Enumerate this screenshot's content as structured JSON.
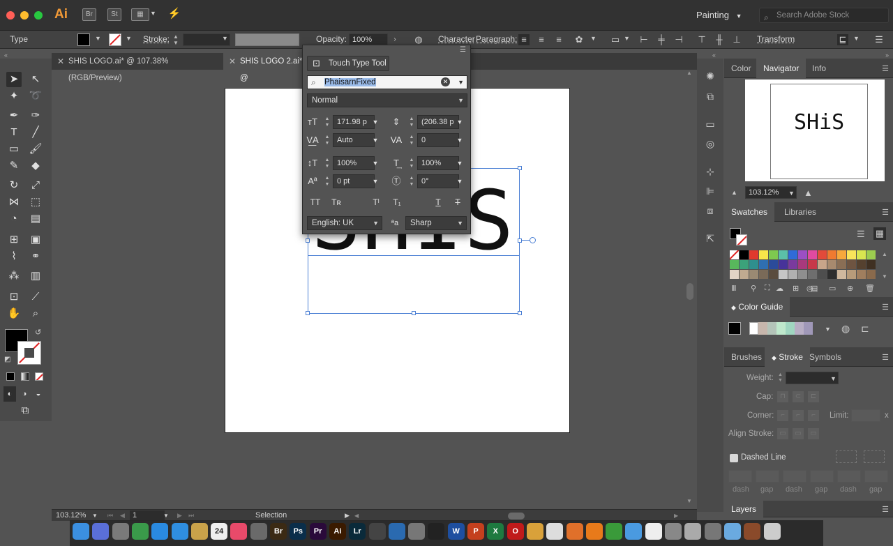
{
  "app": {
    "logo": "Ai",
    "bridge": "Br",
    "stock": "St",
    "workspace": "Painting",
    "search_placeholder": "Search Adobe Stock"
  },
  "control_bar": {
    "tool_label": "Type",
    "stroke_label": "Stroke:",
    "opacity_label": "Opacity:",
    "opacity_value": "100%",
    "character_label": "Character",
    "paragraph_label": "Paragraph:",
    "transform_label": "Transform"
  },
  "tabs": [
    {
      "label": "SHIS LOGO.ai* @ 107.38% (RGB/Preview)"
    },
    {
      "label": "SHIS LOGO 2.ai* @"
    }
  ],
  "canvas": {
    "text": "SHIS"
  },
  "character_panel": {
    "touch_type_label": "Touch Type Tool",
    "font_family": "PhaisarnFixed",
    "font_style": "Normal",
    "font_size": "171.98 p",
    "leading": "(206.38 p",
    "kerning": "Auto",
    "tracking": "0",
    "vertical_scale": "100%",
    "horizontal_scale": "100%",
    "baseline_shift": "0 pt",
    "rotation": "0°",
    "language": "English: UK",
    "antialias": "Sharp"
  },
  "navigator": {
    "tabs": [
      "Color",
      "Navigator",
      "Info"
    ],
    "preview_text": "SHiS",
    "zoom": "103.12%"
  },
  "swatches": {
    "tabs": [
      "Swatches",
      "Libraries"
    ],
    "colors": [
      "#ffffff",
      "#000000",
      "#e03a2d",
      "#f7e64a",
      "#7ec84f",
      "#5bc0a8",
      "#2f6bd8",
      "#9b4fc4",
      "#e04aa0",
      "#e24a3a",
      "#f07a30",
      "#f6a83c",
      "#f9e45a",
      "#d8e650",
      "#9ccc4f",
      "#58b85c",
      "#3ba27a",
      "#2f8f8e",
      "#2f6fb2",
      "#2b4b9a",
      "#47339a",
      "#7a3a9e",
      "#a8397c",
      "#c7384a",
      "#c8a58a",
      "#a88a6e",
      "#8a6e55",
      "#6e5441",
      "#55412f",
      "#3f3022",
      "#e2d4c6",
      "#c0aa90",
      "#9a8a73",
      "#7a6a58",
      "#5a4c3e",
      "#c6c6c6",
      "#b0b0b0",
      "#8e8e8e",
      "#6e6e6e",
      "#4e4e4e",
      "#2e2e2e",
      "#d0b89e",
      "#b89b7a",
      "#a07e5e",
      "#8a6a4c"
    ]
  },
  "color_guide": {
    "title": "Color Guide",
    "swatches": [
      "#000000",
      "#ffffff",
      "#c7b6ac",
      "#b4c4b9",
      "#bfe8cc",
      "#a0d6c0",
      "#b8aec4",
      "#a098b8"
    ]
  },
  "stroke_panel": {
    "tabs": [
      "Brushes",
      "Stroke",
      "Symbols"
    ],
    "weight_label": "Weight:",
    "cap_label": "Cap:",
    "corner_label": "Corner:",
    "limit_label": "Limit:",
    "limit_suffix": "x",
    "align_label": "Align Stroke:",
    "dashed_label": "Dashed Line",
    "dash_labels": [
      "dash",
      "gap",
      "dash",
      "gap",
      "dash",
      "gap"
    ]
  },
  "layers": {
    "title": "Layers"
  },
  "status_bar": {
    "zoom": "103.12%",
    "page": "1",
    "mode": "Selection"
  },
  "mac_dock": {
    "apps": [
      {
        "name": "finder",
        "label": "",
        "color": "#3b8fe0"
      },
      {
        "name": "siri",
        "label": "",
        "color": "#5a6fd8"
      },
      {
        "name": "launchpad",
        "label": "",
        "color": "#7a7a7a"
      },
      {
        "name": "contacts",
        "label": "",
        "color": "#3a9a4a"
      },
      {
        "name": "app-store",
        "label": "",
        "color": "#2a8ae0"
      },
      {
        "name": "safari",
        "label": "",
        "color": "#2f8ee0"
      },
      {
        "name": "notes",
        "label": "",
        "color": "#c9a24a"
      },
      {
        "name": "calendar",
        "label": "24",
        "color": "#eeeeee"
      },
      {
        "name": "music",
        "label": "",
        "color": "#e84a6a"
      },
      {
        "name": "preview",
        "label": "",
        "color": "#6a6a6a"
      },
      {
        "name": "bridge",
        "label": "Br",
        "color": "#3b2a14"
      },
      {
        "name": "photoshop",
        "label": "Ps",
        "color": "#0a2e4a"
      },
      {
        "name": "premiere",
        "label": "Pr",
        "color": "#2a0a3a"
      },
      {
        "name": "illustrator",
        "label": "Ai",
        "color": "#3a1a00"
      },
      {
        "name": "lightroom",
        "label": "Lr",
        "color": "#0a2a3a"
      },
      {
        "name": "claquette",
        "label": "",
        "color": "#444444"
      },
      {
        "name": "chrome-alt",
        "label": "",
        "color": "#2a6ab0"
      },
      {
        "name": "sys-prefs",
        "label": "",
        "color": "#777777"
      },
      {
        "name": "terminal",
        "label": "",
        "color": "#222222"
      },
      {
        "name": "word",
        "label": "W",
        "color": "#1e4fa0"
      },
      {
        "name": "powerpoint",
        "label": "P",
        "color": "#c4401e"
      },
      {
        "name": "excel",
        "label": "X",
        "color": "#1e7a40"
      },
      {
        "name": "opera",
        "label": "O",
        "color": "#c01a1a"
      },
      {
        "name": "chrome",
        "label": "",
        "color": "#d9a13a"
      },
      {
        "name": "scripts",
        "label": "",
        "color": "#dddddd"
      },
      {
        "name": "firefox",
        "label": "",
        "color": "#e0702a"
      },
      {
        "name": "vlc",
        "label": "",
        "color": "#e87a1a"
      },
      {
        "name": "google-chrome",
        "label": "",
        "color": "#3a9a3a"
      },
      {
        "name": "folder-1",
        "label": "",
        "color": "#4a9ae0"
      },
      {
        "name": "document",
        "label": "",
        "color": "#eeeeee"
      },
      {
        "name": "printer",
        "label": "",
        "color": "#888888"
      },
      {
        "name": "keyboard",
        "label": "",
        "color": "#aaaaaa"
      },
      {
        "name": "screenshot",
        "label": "",
        "color": "#777777"
      },
      {
        "name": "folder-2",
        "label": "",
        "color": "#6aaae0"
      },
      {
        "name": "photo",
        "label": "",
        "color": "#8a4a2a"
      },
      {
        "name": "trash",
        "label": "",
        "color": "#cccccc"
      }
    ]
  }
}
